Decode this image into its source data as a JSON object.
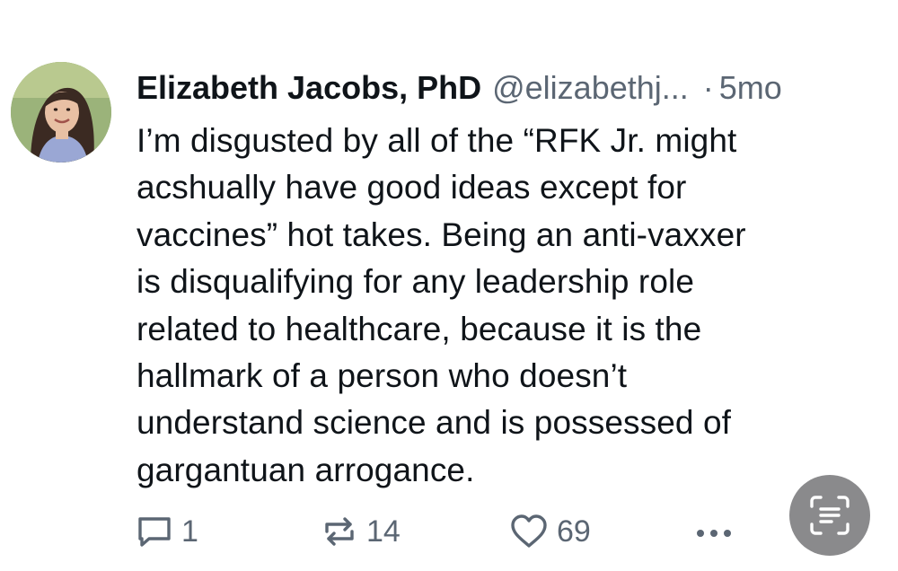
{
  "post": {
    "author": {
      "display_name": "Elizabeth Jacobs, PhD",
      "handle": "@elizabethj...",
      "avatar_icon": "profile-photo"
    },
    "separator": "·",
    "time_ago": "5mo",
    "text_lines": [
      "I’m disgusted by all of the “RFK Jr. might",
      "acshually have good ideas except for",
      "vaccines” hot takes. Being an anti-vaxxer",
      "is disqualifying for any leadership role",
      "related to healthcare, because it is the",
      "hallmark of a person who doesn’t",
      "understand science and is possessed of",
      "gargantuan arrogance."
    ],
    "actions": {
      "reply": {
        "icon": "reply-icon",
        "count": "1"
      },
      "repost": {
        "icon": "repost-icon",
        "count": "14"
      },
      "like": {
        "icon": "heart-icon",
        "count": "69"
      },
      "more": {
        "icon": "more-icon"
      }
    }
  },
  "overlay": {
    "live_text_button": {
      "icon": "text-scan-icon"
    }
  },
  "colors": {
    "text_primary": "#0f1419",
    "text_secondary": "#5b6673",
    "background": "#ffffff",
    "scan_button_bg": "#8a8a8c"
  }
}
